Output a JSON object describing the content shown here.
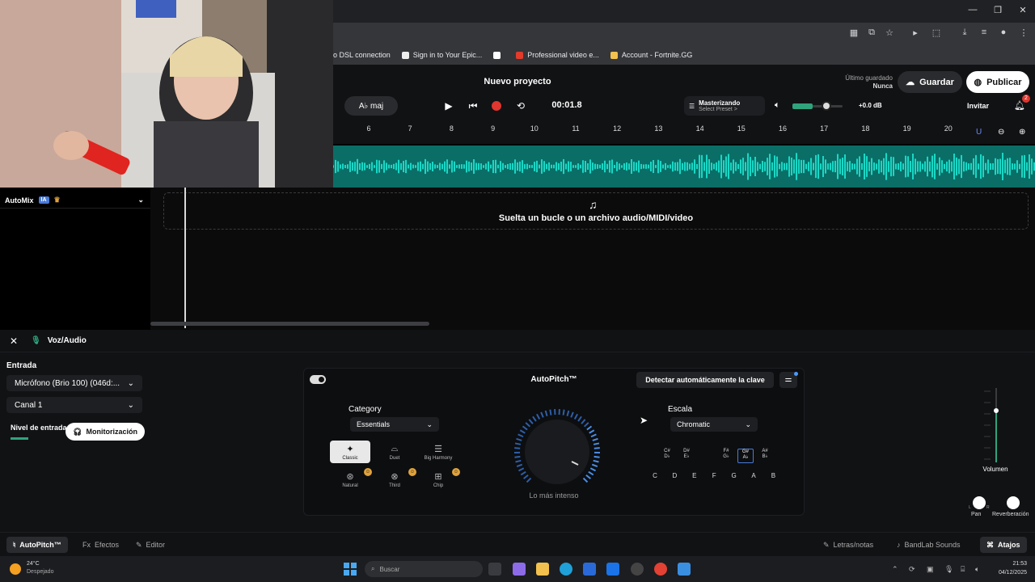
{
  "browser": {
    "bookmarks": [
      {
        "label": "o DSL connection",
        "color": "#1a73e8"
      },
      {
        "label": "Sign in to Your Epic...",
        "color": "#eeeeee"
      },
      {
        "label": "",
        "color": "#ffffff"
      },
      {
        "label": "Professional video e...",
        "color": "#e33a2a"
      },
      {
        "label": "Account - Fortnite.GG",
        "color": "#f2c14e"
      }
    ]
  },
  "header": {
    "project_title": "Nuevo proyecto",
    "saved_label": "Último guardado",
    "saved_value": "Nunca",
    "save_button": "Guardar",
    "publish_button": "Publicar",
    "key_tool": "A♭ maj",
    "time": "00:01.8",
    "master_title": "Masterizando",
    "master_preset": "Select Preset >",
    "volume_level": 0.4,
    "db_value": "+0.0 dB",
    "invite_button": "Invitar",
    "notifications": "2"
  },
  "ruler": {
    "ticks": [
      "6",
      "7",
      "8",
      "9",
      "10",
      "11",
      "12",
      "13",
      "14",
      "15",
      "16",
      "17",
      "18",
      "19",
      "20"
    ]
  },
  "tracks": {
    "automix_label": "AutoMix",
    "ia_badge": "IA",
    "drop_text": "Suelta un bucle o un archivo audio/MIDI/video"
  },
  "panel": {
    "title": "Voz/Audio",
    "input_label": "Entrada",
    "mic_value": "Micrófono (Brio 100) (046d:...",
    "channel_value": "Canal 1",
    "level_label": "Nivel de entrada",
    "monitor_button": "Monitorización",
    "autopitch": {
      "title": "AutoPitch™",
      "detect_button": "Detectar automáticamente la clave",
      "category_label": "Category",
      "category_value": "Essentials",
      "styles": [
        {
          "label": "Classic",
          "icon": "sparkle-icon",
          "selected": true,
          "premium": false
        },
        {
          "label": "Duet",
          "icon": "duet-icon",
          "selected": false,
          "premium": false
        },
        {
          "label": "Big Harmony",
          "icon": "harmony-icon",
          "selected": false,
          "premium": false
        },
        {
          "label": "Natural",
          "icon": "natural-icon",
          "selected": false,
          "premium": true
        },
        {
          "label": "Third",
          "icon": "third-icon",
          "selected": false,
          "premium": true
        },
        {
          "label": "Chip",
          "icon": "chip-icon",
          "selected": false,
          "premium": true
        }
      ],
      "knob_label": "Lo más intenso",
      "scale_label": "Escala",
      "scale_value": "Chromatic",
      "sharps": [
        {
          "top": "C#",
          "bottom": "D♭",
          "on": false
        },
        {
          "top": "D#",
          "bottom": "E♭",
          "on": false
        },
        {
          "top": "F#",
          "bottom": "G♭",
          "on": false
        },
        {
          "top": "G#",
          "bottom": "A♭",
          "on": true
        },
        {
          "top": "A#",
          "bottom": "B♭",
          "on": false
        }
      ],
      "naturals": [
        "C",
        "D",
        "E",
        "F",
        "G",
        "A",
        "B"
      ]
    },
    "volume_label": "Volumen",
    "pan_label": "Pan",
    "reverb_label": "Reverberación",
    "pan_l": "L",
    "pan_r": "R"
  },
  "bottom_tabs": {
    "autopitch": "AutoPitch™",
    "effects": "Efectos",
    "editor": "Editor",
    "lyrics": "Letras/notas",
    "sounds": "BandLab Sounds",
    "shortcuts": "Atajos"
  },
  "taskbar": {
    "temp": "24°C",
    "weather": "Despejado",
    "search_placeholder": "Buscar",
    "time": "21:53",
    "date": "04/12/2025"
  }
}
